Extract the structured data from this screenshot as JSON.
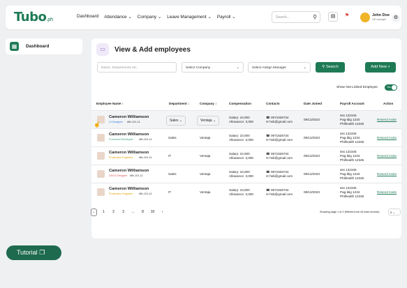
{
  "brand": {
    "logo": "Tubo",
    "suffix": ".ph",
    "accent": "#1e7a55"
  },
  "nav": [
    "Dashboard",
    "Attendance ⌄",
    "Company ⌄",
    "Leave Management ⌄",
    "Payroll ⌄"
  ],
  "search": {
    "placeholder": "Search..."
  },
  "user": {
    "name": "John Doe",
    "role": "HR manager"
  },
  "sidebar": {
    "item": "Dashboard"
  },
  "page": {
    "title": "View & Add employees"
  },
  "filters": {
    "dept_placeholder": "Name, Departments etc.",
    "company": "Select Company",
    "manager": "Select Assign Manager",
    "search_btn": "Search",
    "add_btn": "Add New +"
  },
  "toggle": {
    "label": "Show Not Linked Employee",
    "value": "Yes"
  },
  "columns": [
    "Employee Name ↕",
    "Department ↕",
    "Company ↕",
    "Compensation",
    "Contacts",
    "Date Joined",
    "Payroll Account",
    "Action"
  ],
  "rows": [
    {
      "name": "Cameron Williamson",
      "tag": "UI Designer",
      "tag_color": "#2f7bd9",
      "id": "#Br-101-11",
      "dept": "Sales",
      "company": "Ventaja",
      "salary": "Salary: 10,000",
      "allowance": "Allowance: 3,000",
      "phone": "☎ 0971826734",
      "email": "✉ hsb@gmail.com",
      "date": "09/12/2023",
      "sss": "sss 122345",
      "pagibig": "Pag-ibig 1234",
      "phil": "Philhealth 12345",
      "action": "Resend Invite",
      "selected": true
    },
    {
      "name": "Cameron Williamson",
      "tag": "Front-end Developer",
      "tag_color": "#2f9a6a",
      "id": "#Br-101-11",
      "dept": "Sales",
      "company": "Ventaja",
      "salary": "Salary: 10,000",
      "allowance": "Allowance: 3,000",
      "phone": "☎ 0971826734",
      "email": "✉ hsb@gmail.com",
      "date": "09/12/2023",
      "sss": "sss 122345",
      "pagibig": "Pag-ibig 1234",
      "phil": "Philhealth 12345",
      "action": "Resend Invite",
      "selected": false
    },
    {
      "name": "Cameron Williamson",
      "tag": "Production Engineer",
      "tag_color": "#e0a000",
      "id": "#Br-101-11",
      "dept": "IT",
      "company": "Ventaja",
      "salary": "Salary: 10,000",
      "allowance": "Allowance: 3,000",
      "phone": "☎ 0971826734",
      "email": "✉ hsb@gmail.com",
      "date": "09/12/2023",
      "sss": "sss 122345",
      "pagibig": "Pag-ibig 1234",
      "phil": "Philhealth 12345",
      "action": "Resend Invite",
      "selected": false
    },
    {
      "name": "Cameron Williamson",
      "tag": "UX/UI Designer",
      "tag_color": "#d9534f",
      "id": "#Br-101-11",
      "dept": "Sales",
      "company": "Ventaja",
      "salary": "Salary: 10,000",
      "allowance": "Allowance: 3,000",
      "phone": "☎ 0971826734",
      "email": "✉ hsb@gmail.com",
      "date": "09/12/2023",
      "sss": "sss 122345",
      "pagibig": "Pag-ibig 1234",
      "phil": "Philhealth 12345",
      "action": "Resend Invite",
      "selected": false
    },
    {
      "name": "Cameron Williamson",
      "tag": "Production Engineer",
      "tag_color": "#e0a000",
      "id": "#Br-101-11",
      "dept": "IT",
      "company": "Ventaja",
      "salary": "Salary: 10,000",
      "allowance": "Allowance: 3,000",
      "phone": "☎ 0971826734",
      "email": "✉ hsb@gmail.com",
      "date": "09/12/2023",
      "sss": "sss 122345",
      "pagibig": "Pag-ibig 1234",
      "phil": "Philhealth 12345",
      "action": "Resend Invite",
      "selected": false
    }
  ],
  "pagination": {
    "pages": [
      "1",
      "2",
      "3",
      "...",
      "8",
      "10"
    ],
    "info": "Showing page 1 of 2 (filtered from 44 total records)",
    "per_page": "5"
  },
  "tutorial": {
    "label": "Tutorial"
  }
}
